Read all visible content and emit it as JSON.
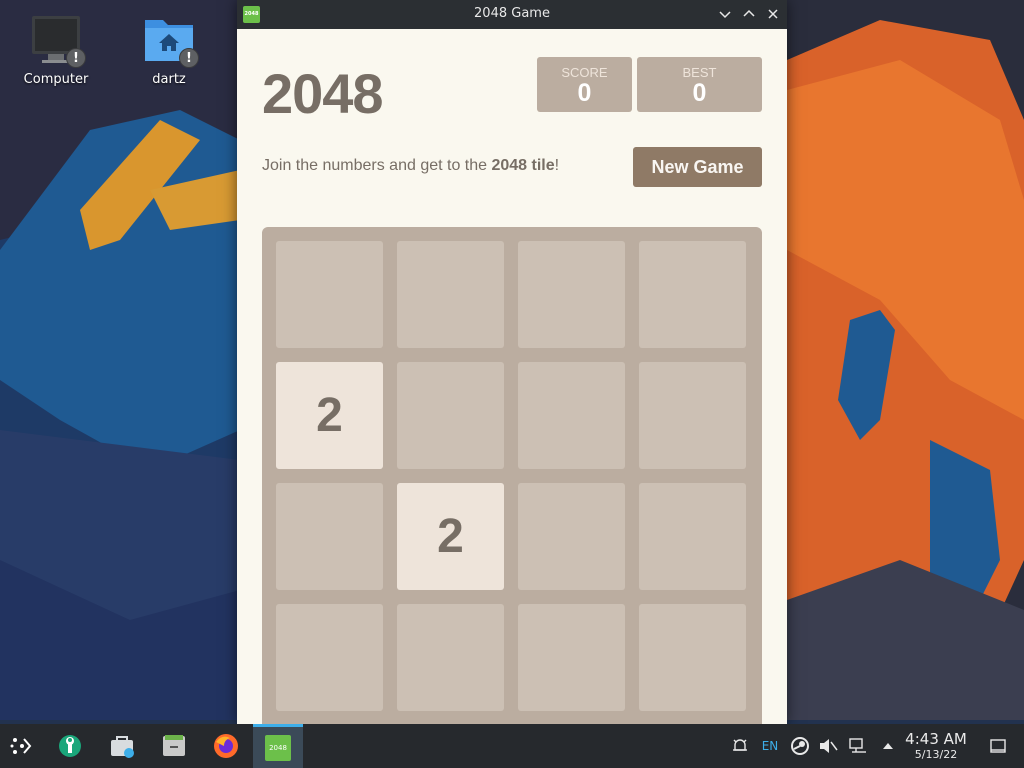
{
  "desktop": {
    "icons": [
      {
        "label": "Computer",
        "badge": "!"
      },
      {
        "label": "dartz",
        "badge": "!"
      }
    ]
  },
  "window": {
    "title": "2048 Game",
    "app_icon_text": "2048"
  },
  "game": {
    "title": "2048",
    "score_label": "SCORE",
    "score": "0",
    "best_label": "BEST",
    "best": "0",
    "intro_prefix": "Join the numbers and get to the ",
    "intro_bold": "2048 tile",
    "intro_suffix": "!",
    "new_game_label": "New Game",
    "board": [
      [
        "",
        "",
        "",
        ""
      ],
      [
        "2",
        "",
        "",
        ""
      ],
      [
        "",
        "2",
        "",
        ""
      ],
      [
        "",
        "",
        "",
        ""
      ]
    ]
  },
  "taskbar": {
    "active_task_label": "2048",
    "tray_lang": "EN",
    "time": "4:43 AM",
    "date": "5/13/22"
  },
  "colors": {
    "accent": "#3daee9",
    "tile_2": "#eee4da",
    "board_bg": "#bbada0",
    "button_bg": "#8f7a66"
  }
}
